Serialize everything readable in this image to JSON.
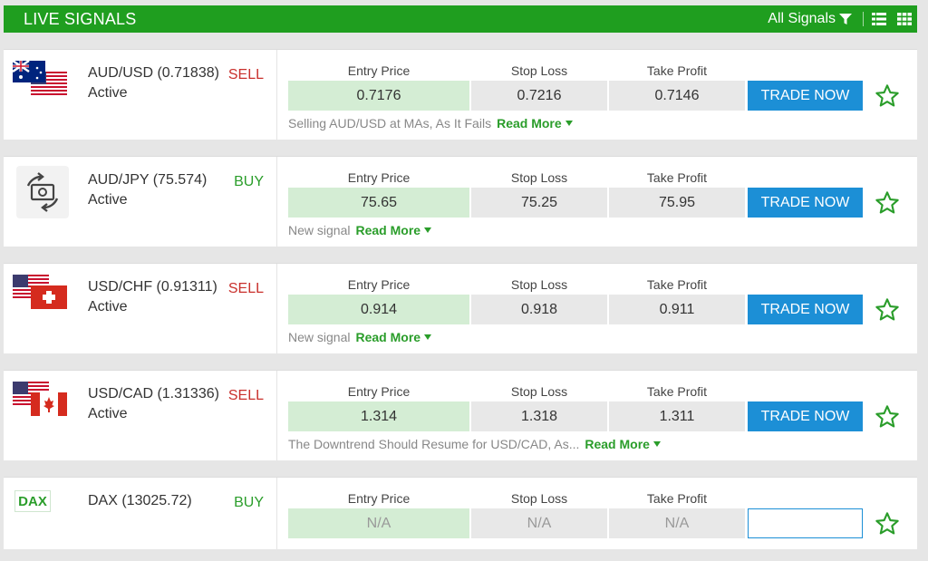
{
  "header": {
    "title": "LIVE SIGNALS",
    "filter_label": "All Signals"
  },
  "columns": {
    "entry": "Entry Price",
    "stop": "Stop Loss",
    "take": "Take Profit"
  },
  "colors": {
    "header_green": "#1f9e1f",
    "sell_red": "#c9302c",
    "buy_green": "#2a9d2a",
    "trade_blue": "#1c8fd6",
    "entry_bg": "#d4edd4"
  },
  "signals": [
    {
      "pair": "AUD/USD (0.71838)",
      "direction": "SELL",
      "status": "Active",
      "entry": "0.7176",
      "stop": "0.7216",
      "take": "0.7146",
      "button": "TRADE NOW",
      "description": "Selling AUD/USD at MAs, As It Fails",
      "read_more": "Read More",
      "icon": "aud-usd-flags"
    },
    {
      "pair": "AUD/JPY (75.574)",
      "direction": "BUY",
      "status": "Active",
      "entry": "75.65",
      "stop": "75.25",
      "take": "75.95",
      "button": "TRADE NOW",
      "description": "New signal",
      "read_more": "Read More",
      "icon": "currency-exchange-icon"
    },
    {
      "pair": "USD/CHF (0.91311)",
      "direction": "SELL",
      "status": "Active",
      "entry": "0.914",
      "stop": "0.918",
      "take": "0.911",
      "button": "TRADE NOW",
      "description": "New signal",
      "read_more": "Read More",
      "icon": "usd-chf-flags"
    },
    {
      "pair": "USD/CAD (1.31336)",
      "direction": "SELL",
      "status": "Active",
      "entry": "1.314",
      "stop": "1.318",
      "take": "1.311",
      "button": "TRADE NOW",
      "description": "The Downtrend Should Resume for USD/CAD, As...",
      "read_more": "Read More",
      "icon": "usd-cad-flags"
    },
    {
      "pair": "DAX (13025.72)",
      "direction": "BUY",
      "badge": "DAX",
      "entry": "N/A",
      "stop": "N/A",
      "take": "N/A",
      "icon": "dax-badge"
    }
  ]
}
